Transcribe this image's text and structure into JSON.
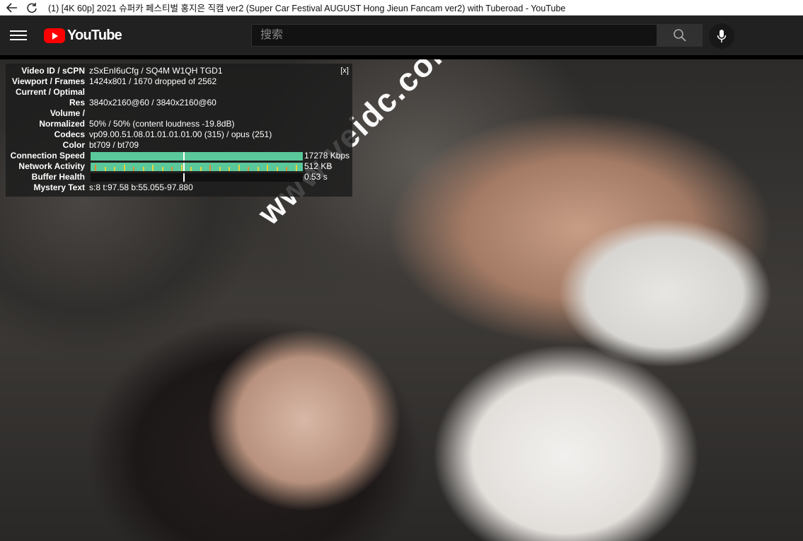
{
  "window": {
    "title": "(1) [4K 60p] 2021 슈퍼카 페스티벌 홍지은 직캠 ver2 (Super Car Festival AUGUST Hong Jieun Fancam ver2) with Tuberoad - YouTube"
  },
  "header": {
    "logo_text": "YouTube",
    "search_placeholder": "搜索",
    "icons": [
      "menu-icon",
      "youtube-logo-icon",
      "search-icon",
      "mic-icon"
    ]
  },
  "video": {
    "watermark": "www.veidc.com"
  },
  "stats": {
    "close_label": "[x]",
    "rows": [
      {
        "label": "Video ID / sCPN",
        "value": "zSxEnI6uCfg / SQ4M W1QH TGD1"
      },
      {
        "label": "Viewport / Frames",
        "value": "1424x801 / 1670 dropped of 2562"
      },
      {
        "label": "Current / Optimal",
        "value": ""
      },
      {
        "label": "Res",
        "value": "3840x2160@60 / 3840x2160@60"
      },
      {
        "label": "Volume /",
        "value": ""
      },
      {
        "label": "Normalized",
        "value": "50% / 50% (content loudness -19.8dB)"
      },
      {
        "label": "Codecs",
        "value": "vp09.00.51.08.01.01.01.01.00 (315) / opus (251)"
      },
      {
        "label": "Color",
        "value": "bt709 / bt709"
      }
    ],
    "graphs": [
      {
        "label": "Connection Speed",
        "value": "17278 Kbps"
      },
      {
        "label": "Network Activity",
        "value": "512 KB"
      },
      {
        "label": "Buffer Health",
        "value": "0.53 s"
      }
    ],
    "mystery": {
      "label": "Mystery Text",
      "value": "s:8 t:97.58 b:55.055-97.880"
    },
    "colors": {
      "graph_fill": "#5ac89a",
      "accent_orange": "#e08a2e",
      "accent_yellow": "#e8d23a"
    }
  }
}
